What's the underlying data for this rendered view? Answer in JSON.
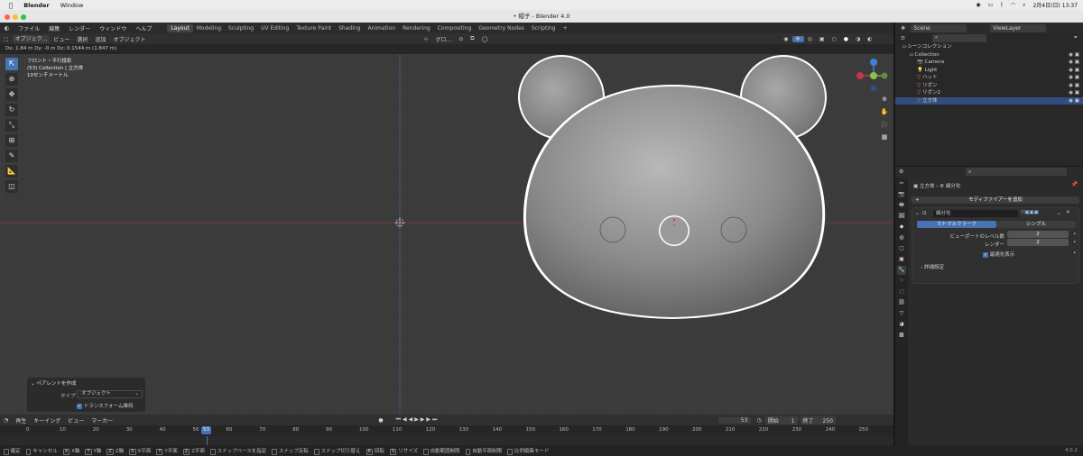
{
  "macos": {
    "app_name": "Blender",
    "menus": [
      "Window"
    ],
    "date_time": "2月4日(日) 13:37"
  },
  "window": {
    "title": "• 帽子 - Blender 4.0"
  },
  "topbar": {
    "menus": [
      "ファイル",
      "編集",
      "レンダー",
      "ウィンドウ",
      "ヘルプ"
    ],
    "workspaces": [
      "Layout",
      "Modeling",
      "Sculpting",
      "UV Editing",
      "Texture Paint",
      "Shading",
      "Animation",
      "Rendering",
      "Compositing",
      "Geometry Nodes",
      "Scripting"
    ],
    "active_workspace": "Layout",
    "add_tab": "+"
  },
  "viewport": {
    "mode": "オブジェク...",
    "menus": [
      "ビュー",
      "選択",
      "追加",
      "オブジェクト"
    ],
    "orientation": "グロ...",
    "status": "Dx: 1.84 m  Dy: -0 m  Dz: 0.1544 m (1.847 m)",
    "info": [
      "フロント・平行投影",
      "(53) Collection | 立方体",
      "10センチメートル"
    ],
    "accent_color": "#4772b3",
    "tools": [
      "select-cursor",
      "cursor",
      "move",
      "rotate",
      "scale",
      "transform",
      "annotate",
      "measure",
      "add-cube"
    ]
  },
  "operator_panel": {
    "title": "ペアレントを作成",
    "type_label": "タイプ",
    "type_value": "オブジェクト",
    "keep_transform_label": "トランスフォーム維持",
    "keep_transform_checked": true
  },
  "timeline": {
    "menus": [
      "再生",
      "キーイング",
      "ビュー",
      "マーカー"
    ],
    "current_frame": "53",
    "current_frame_ruler": "53",
    "start_label": "開始",
    "start_value": "1",
    "end_label": "終了",
    "end_value": "250",
    "ticks": [
      "0",
      "10",
      "20",
      "30",
      "40",
      "50",
      "60",
      "70",
      "80",
      "90",
      "100",
      "110",
      "120",
      "130",
      "140",
      "150",
      "160",
      "170",
      "180",
      "190",
      "200",
      "210",
      "220",
      "230",
      "240",
      "250"
    ]
  },
  "statusbar": {
    "items": [
      {
        "key": "",
        "label": "確定"
      },
      {
        "key": "",
        "label": "キャンセル"
      },
      {
        "key": "X",
        "label": "X軸"
      },
      {
        "key": "Y",
        "label": "Y軸"
      },
      {
        "key": "Z",
        "label": "Z軸"
      },
      {
        "key": "X",
        "label": "X平面"
      },
      {
        "key": "Y",
        "label": "Y平面"
      },
      {
        "key": "Z",
        "label": "Z平面"
      },
      {
        "key": "",
        "label": "スナップベースを指定"
      },
      {
        "key": "",
        "label": "スナップ反転"
      },
      {
        "key": "",
        "label": "スナップ切り替え"
      },
      {
        "key": "R",
        "label": "回転"
      },
      {
        "key": "S",
        "label": "リサイズ"
      },
      {
        "key": "",
        "label": "自動範囲制限"
      },
      {
        "key": "",
        "label": "自動平面制限"
      },
      {
        "key": "",
        "label": "比例編集モード"
      }
    ],
    "version": "4.0.2"
  },
  "outliner": {
    "scene": "Scene",
    "view_layer": "ViewLayer",
    "root": "シーンコレクション",
    "items": [
      {
        "name": "Collection",
        "indent": 1,
        "selected": false
      },
      {
        "name": "Camera",
        "indent": 2,
        "selected": false
      },
      {
        "name": "Light",
        "indent": 2,
        "selected": false
      },
      {
        "name": "ハット",
        "indent": 2,
        "selected": false
      },
      {
        "name": "リボン",
        "indent": 2,
        "selected": false
      },
      {
        "name": "リボン2",
        "indent": 2,
        "selected": false
      },
      {
        "name": "立方体",
        "indent": 2,
        "selected": true
      }
    ]
  },
  "properties": {
    "breadcrumb_object": "立方体",
    "breadcrumb_modifier": "細分化",
    "add_modifier": "モディファイアーを追加",
    "modifier_name": "細分化",
    "tab_catmull": "カトマルクラーク",
    "tab_simple": "シンプル",
    "viewport_levels_label": "ビューポートのレベル数",
    "viewport_levels": "2",
    "render_label": "レンダー",
    "render_levels": "2",
    "optimal_display_label": "最適化表示",
    "optimal_display_checked": true,
    "advanced_label": "詳細設定"
  }
}
